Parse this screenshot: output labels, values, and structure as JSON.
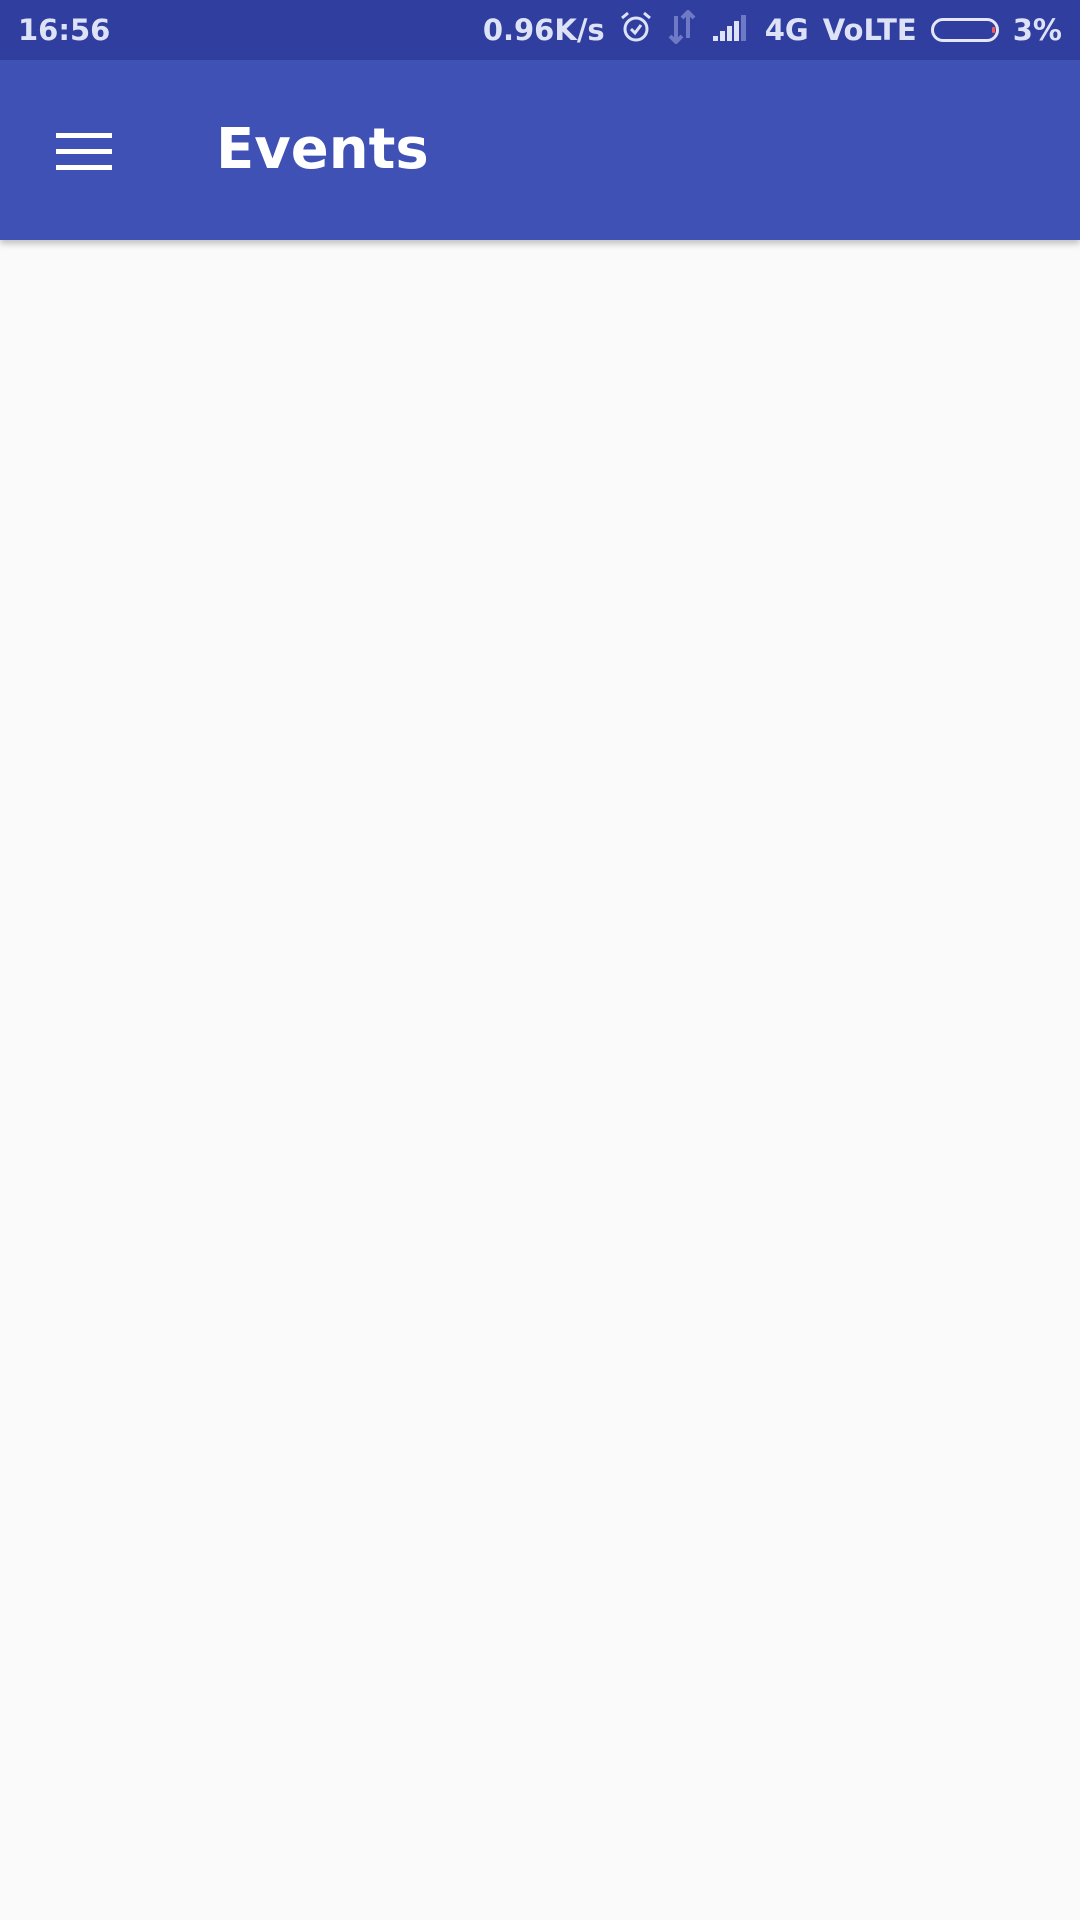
{
  "status_bar": {
    "time": "16:56",
    "network_speed": "0.96K/s",
    "network_type": "4G",
    "volte": "VoLTE",
    "battery_percent": "3%",
    "icons": [
      "alarm-icon",
      "data-transfer-icon",
      "signal-icon",
      "battery-icon"
    ]
  },
  "app_bar": {
    "title": "Events",
    "menu_icon": "hamburger-menu-icon",
    "color": "#3f51b5"
  },
  "colors": {
    "status_bar": "#303f9f",
    "app_bar": "#3f51b5",
    "background": "#fafafa"
  }
}
